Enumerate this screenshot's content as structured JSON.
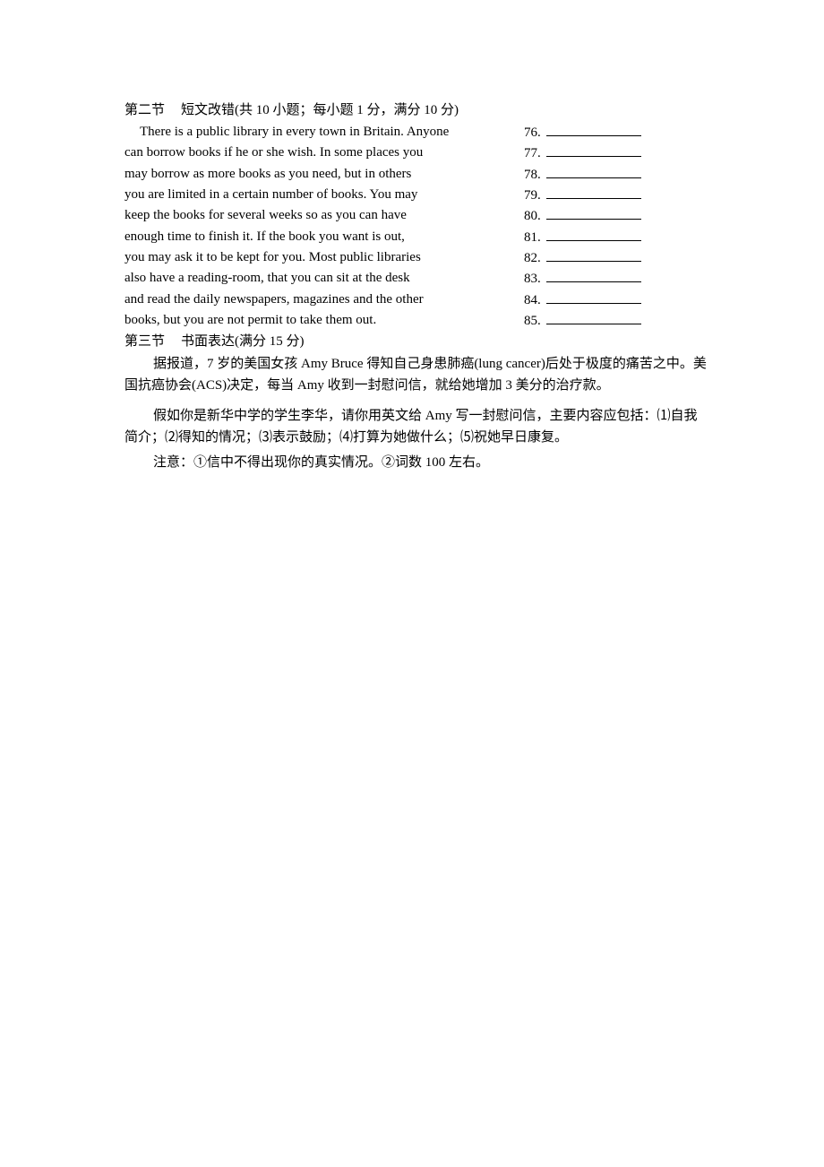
{
  "section2": {
    "heading_part": "第二节",
    "heading_title": "短文改错(共 10 小题；每小题 1 分，满分 10 分)",
    "passage_lines": [
      "There is a public library in every town in Britain. Anyone",
      "can borrow books if he or she wish. In some places you",
      "may borrow as more books as you need, but in others",
      "you are limited in a certain number of books. You may",
      "keep the books for several weeks so as you can have",
      "enough time to finish it. If the book you want is out,",
      "you may ask it to be kept for you. Most public libraries",
      "also have a reading-room, that you can sit at the desk",
      "and read the daily newspapers, magazines and the other",
      "books, but you are not permit to take them out."
    ],
    "answers": [
      {
        "number": "76.",
        "value": ""
      },
      {
        "number": "77.",
        "value": ""
      },
      {
        "number": "78.",
        "value": ""
      },
      {
        "number": "79.",
        "value": ""
      },
      {
        "number": "80.",
        "value": ""
      },
      {
        "number": "81.",
        "value": ""
      },
      {
        "number": "82.",
        "value": ""
      },
      {
        "number": "83.",
        "value": ""
      },
      {
        "number": "84.",
        "value": ""
      },
      {
        "number": "85.",
        "value": ""
      }
    ]
  },
  "section3": {
    "heading_part": "第三节",
    "heading_title": "书面表达(满分 15 分)",
    "paragraphs": [
      "据报道，7 岁的美国女孩 Amy Bruce 得知自己身患肺癌(lung cancer)后处于极度的痛苦之中。美国抗癌协会(ACS)决定，每当 Amy 收到一封慰问信，就给她增加 3 美分的治疗款。",
      "假如你是新华中学的学生李华，请你用英文给 Amy 写一封慰问信，主要内容应包括：⑴自我简介；⑵得知的情况；⑶表示鼓励；⑷打算为她做什么；⑸祝她早日康复。",
      "注意：①信中不得出现你的真实情况。②词数 100 左右。"
    ]
  }
}
